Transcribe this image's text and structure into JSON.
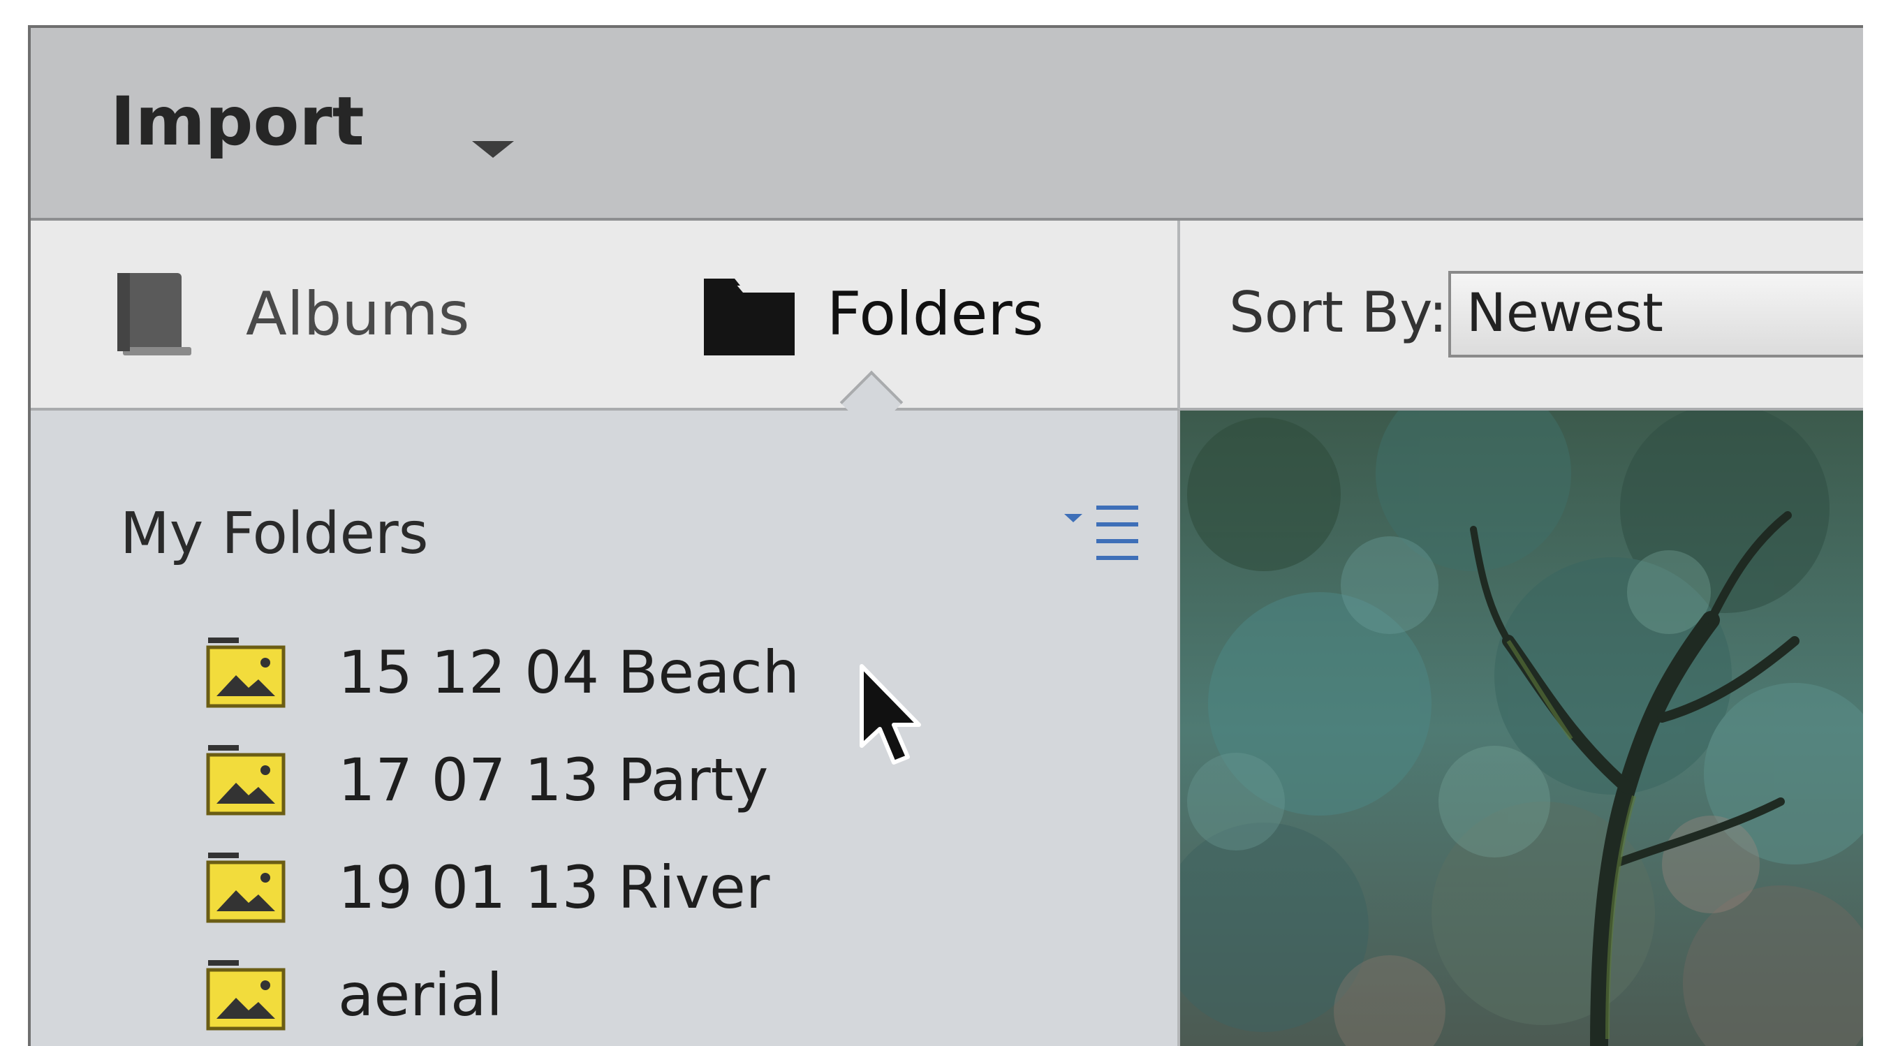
{
  "header": {
    "title": "Import"
  },
  "tabs": [
    {
      "label": "Albums",
      "icon": "album-icon"
    },
    {
      "label": "Folders",
      "icon": "folder-icon",
      "selected": true
    }
  ],
  "sort": {
    "label": "Sort By:",
    "value": "Newest"
  },
  "folders_panel": {
    "title": "My Folders",
    "items": [
      {
        "label": "15 12 04 Beach"
      },
      {
        "label": "17 07 13 Party"
      },
      {
        "label": "19 01 13 River"
      },
      {
        "label": "aerial"
      }
    ]
  },
  "colors": {
    "header_bg": "#c1c2c4",
    "panel_bg": "#d4d7db",
    "tab_bg": "#eaeaea",
    "folder_icon_fill": "#f2dc3c",
    "menu_accent": "#3e6fb8"
  }
}
